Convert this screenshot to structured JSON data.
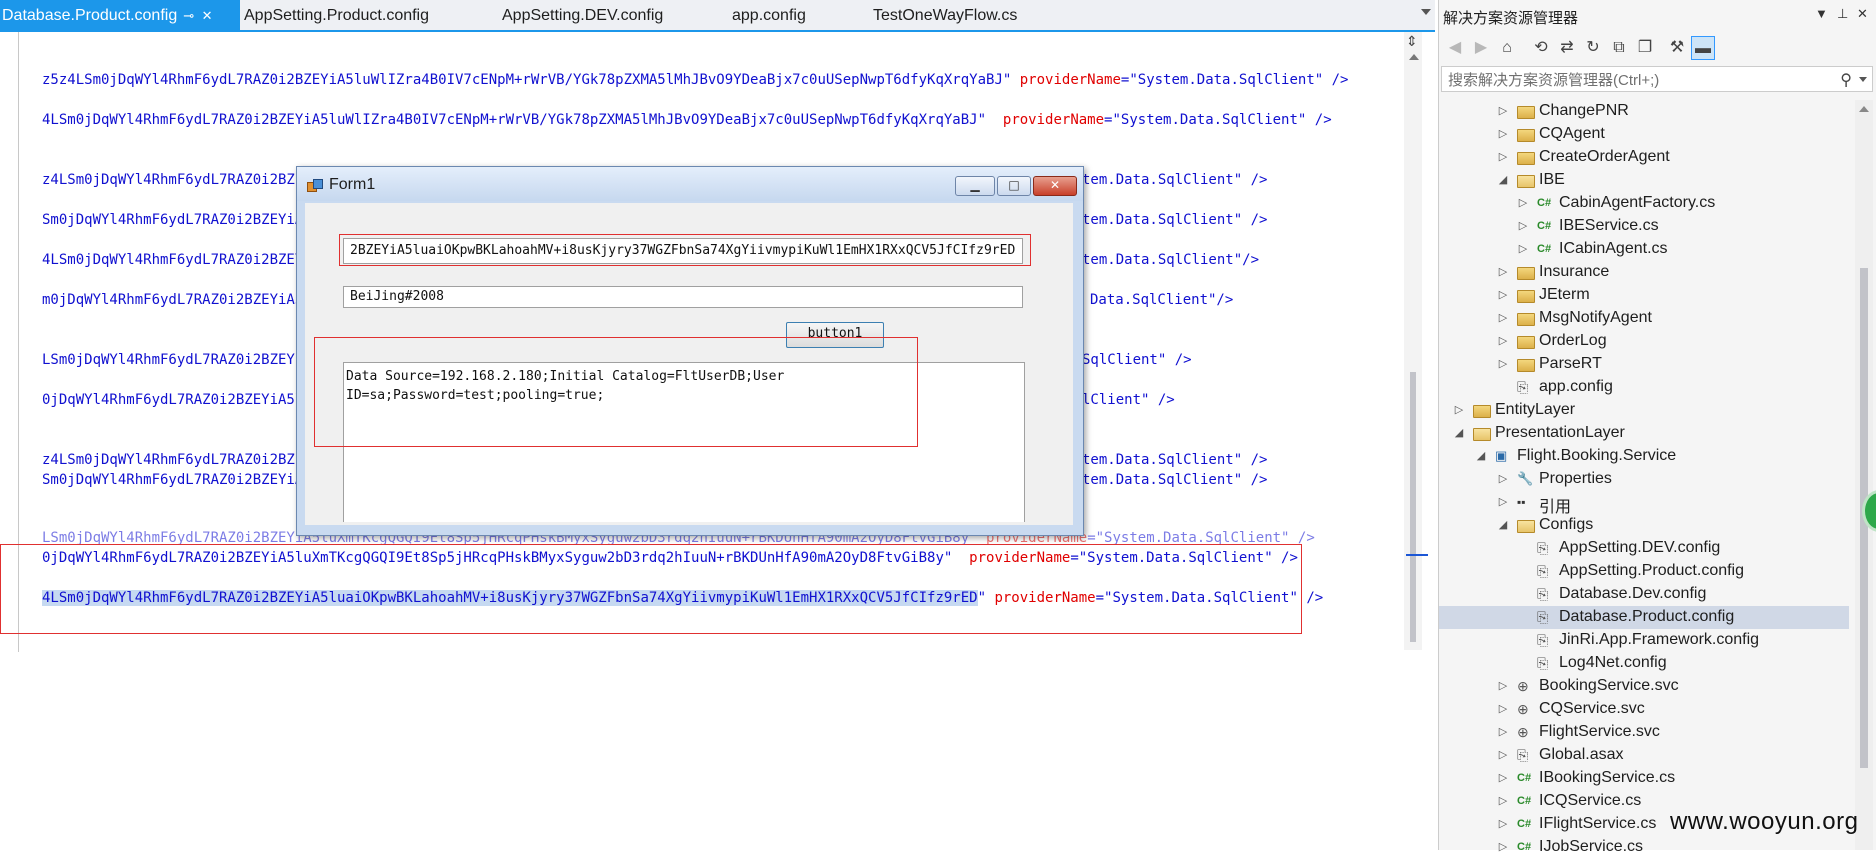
{
  "tabs": [
    {
      "label": "Database.Product.config",
      "active": true
    },
    {
      "label": "AppSetting.Product.config",
      "active": false
    },
    {
      "label": "AppSetting.DEV.config",
      "active": false
    },
    {
      "label": "app.config",
      "active": false
    },
    {
      "label": "TestOneWayFlow.cs",
      "active": false
    }
  ],
  "editor": {
    "lines": [
      {
        "value": "z5z4LSm0jDqWYl4RhmF6ydL7RAZ0i2BZEYiA5luWlIZra4B0IV7cENpM+rWrVB/YGk78pZXMA5lMhJBvO9YDeaBjx7c0uUSepNwpT6dfyKqXrqYaBJ\"",
        "attr": "providerName",
        "attr_val": "=\"System.Data.SqlClient\" />"
      },
      {
        "value": "4LSm0jDqWYl4RhmF6ydL7RAZ0i2BZEYiA5luWlIZra4B0IV7cENpM+rWrVB/YGk78pZXMA5lMhJBvO9YDeaBjx7c0uUSepNwpT6dfyKqXrqYaBJ\" ",
        "attr": "providerName",
        "attr_val": "=\"System.Data.SqlClient\" />"
      },
      {
        "value": "z4LSm0jDqWYl4RhmF6ydL7RAZ0i2BZEY",
        "tail": "tem.Data.SqlClient\" />"
      },
      {
        "value": "Sm0jDqWYl4RhmF6ydL7RAZ0i2BZEYiA5",
        "tail": "tem.Data.SqlClient\" />"
      },
      {
        "value": "4LSm0jDqWYl4RhmF6ydL7RAZ0i2BZEYi",
        "tail": "tem.Data.SqlClient\"/>"
      },
      {
        "value": "m0jDqWYl4RhmF6ydL7RAZ0i2BZEYiA5l",
        "tail": "Data.SqlClient\"/>"
      },
      {
        "value": "LSm0jDqWYl4RhmF6ydL7RAZ0i2BZEYiA",
        "tail": "SqlClient\" />"
      },
      {
        "value": "0jDqWYl4RhmF6ydL7RAZ0i2BZEYiA5lu",
        "tail": "lClient\" />"
      },
      {
        "value": "z4LSm0jDqWYl4RhmF6ydL7RAZ0i2BZEY",
        "tail": "tem.Data.SqlClient\" />"
      },
      {
        "value": "Sm0jDqWYl4RhmF6ydL7RAZ0i2BZEYiA5",
        "tail": "tem.Data.SqlClient\" />"
      },
      {
        "value": "LSm0jDqWYl4RhmF6ydL7RAZ0i2BZEYiA5luXmTKcgQGQI9Et8Sp5jHRcqPHskBMyxSyguw2bD3rdq2hIuuN+rBKDUnHfA90mA2OyD8FtvGiB8y\"",
        "attr": "providerName",
        "attr_val": "=\"System.Data.SqlClient\" />"
      },
      {
        "value": "0jDqWYl4RhmF6ydL7RAZ0i2BZEYiA5luXmTKcgQGQI9Et8Sp5jHRcqPHskBMyxSyguw2bD3rdq2hIuuN+rBKDUnHfA90mA2OyD8FtvGiB8y\" ",
        "attr": "providerName",
        "attr_val": "=\"System.Data.SqlClient\" />"
      },
      {
        "value": "4LSm0jDqWYl4RhmF6ydL7RAZ0i2BZEYiA5luaiOKpwBKLahoahMV+i8usKjyry37WGZFbnSa74XgYiivmypiKuWl1EmHX1RXxQCV5JfCIfz9rED",
        "attr": "providerName",
        "attr_val": "=\"System.Data.SqlClient\" />"
      }
    ]
  },
  "form1": {
    "title": "Form1",
    "minimize_glyph": "▁",
    "maximize_glyph": "□",
    "close_glyph": "✕",
    "encrypted_value": "2BZEYiA5luaiOKpwBKLahoahMV+i8usKjyry37WGZFbnSa74XgYiivmypiKuWl1EmHX1RXxQCV5JfCIfz9rED",
    "password_value": "BeiJing#2008",
    "button_label": "button1",
    "result_line1": "Data Source=192.168.2.180;Initial Catalog=FltUserDB;User",
    "result_line2": "ID=sa;Password=test;pooling=true;"
  },
  "explorer": {
    "title": "解决方案资源管理器",
    "pin_glyph": "▼",
    "autohide_glyph": "⊥",
    "close_glyph": "✕",
    "search_placeholder": "搜索解决方案资源管理器(Ctrl+;)",
    "tree": [
      {
        "label": "ChangePNR",
        "icon": "folder",
        "depth": 2,
        "exp": "closed"
      },
      {
        "label": "CQAgent",
        "icon": "folder",
        "depth": 2,
        "exp": "closed"
      },
      {
        "label": "CreateOrderAgent",
        "icon": "folder",
        "depth": 2,
        "exp": "closed"
      },
      {
        "label": "IBE",
        "icon": "folder-open",
        "depth": 2,
        "exp": "open"
      },
      {
        "label": "CabinAgentFactory.cs",
        "icon": "cs",
        "depth": 3,
        "exp": "closed"
      },
      {
        "label": "IBEService.cs",
        "icon": "cs",
        "depth": 3,
        "exp": "closed"
      },
      {
        "label": "ICabinAgent.cs",
        "icon": "cs",
        "depth": 3,
        "exp": "closed"
      },
      {
        "label": "Insurance",
        "icon": "folder",
        "depth": 2,
        "exp": "closed"
      },
      {
        "label": "JEterm",
        "icon": "folder",
        "depth": 2,
        "exp": "closed"
      },
      {
        "label": "MsgNotifyAgent",
        "icon": "folder",
        "depth": 2,
        "exp": "closed"
      },
      {
        "label": "OrderLog",
        "icon": "folder",
        "depth": 2,
        "exp": "closed"
      },
      {
        "label": "ParseRT",
        "icon": "folder",
        "depth": 2,
        "exp": "closed"
      },
      {
        "label": "app.config",
        "icon": "config",
        "depth": 2,
        "exp": "none"
      },
      {
        "label": "EntityLayer",
        "icon": "folder",
        "depth": 0,
        "exp": "closed"
      },
      {
        "label": "PresentationLayer",
        "icon": "folder-open",
        "depth": 0,
        "exp": "open"
      },
      {
        "label": "Flight.Booking.Service",
        "icon": "proj",
        "depth": 1,
        "exp": "open"
      },
      {
        "label": "Properties",
        "icon": "wrench",
        "depth": 2,
        "exp": "closed"
      },
      {
        "label": "引用",
        "icon": "ref",
        "depth": 2,
        "exp": "closed"
      },
      {
        "label": "Configs",
        "icon": "folder-open",
        "depth": 2,
        "exp": "open"
      },
      {
        "label": "AppSetting.DEV.config",
        "icon": "config",
        "depth": 3,
        "exp": "none"
      },
      {
        "label": "AppSetting.Product.config",
        "icon": "config",
        "depth": 3,
        "exp": "none"
      },
      {
        "label": "Database.Dev.config",
        "icon": "config",
        "depth": 3,
        "exp": "none"
      },
      {
        "label": "Database.Product.config",
        "icon": "config",
        "depth": 3,
        "exp": "none",
        "selected": true
      },
      {
        "label": "JinRi.App.Framework.config",
        "icon": "config",
        "depth": 3,
        "exp": "none"
      },
      {
        "label": "Log4Net.config",
        "icon": "config",
        "depth": 3,
        "exp": "none"
      },
      {
        "label": "BookingService.svc",
        "icon": "svc",
        "depth": 2,
        "exp": "closed"
      },
      {
        "label": "CQService.svc",
        "icon": "svc",
        "depth": 2,
        "exp": "closed"
      },
      {
        "label": "FlightService.svc",
        "icon": "svc",
        "depth": 2,
        "exp": "closed"
      },
      {
        "label": "Global.asax",
        "icon": "config",
        "depth": 2,
        "exp": "closed"
      },
      {
        "label": "IBookingService.cs",
        "icon": "cs",
        "depth": 2,
        "exp": "closed"
      },
      {
        "label": "ICQService.cs",
        "icon": "cs",
        "depth": 2,
        "exp": "closed"
      },
      {
        "label": "IFlightService.cs",
        "icon": "cs",
        "depth": 2,
        "exp": "closed"
      },
      {
        "label": "IJobService.cs",
        "icon": "cs",
        "depth": 2,
        "exp": "closed"
      }
    ]
  },
  "watermark": "www.wooyun.org",
  "colors": {
    "accent": "#1c97ea",
    "highlight_box": "#e03030",
    "code_blue": "#1010d0",
    "code_red": "#e00000"
  }
}
